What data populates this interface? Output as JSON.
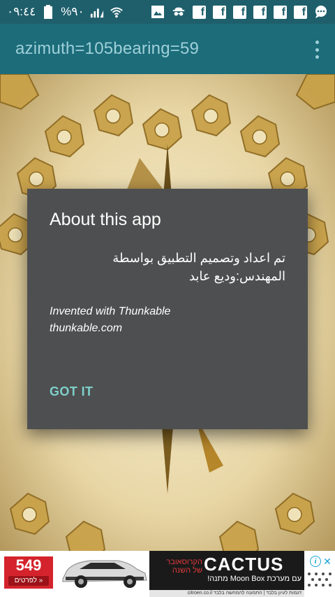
{
  "status_bar": {
    "time": "٠٩:٤٤",
    "battery": "%٩٠",
    "icons": [
      "battery-icon",
      "signal-icon",
      "wifi-icon",
      "gallery-icon",
      "spy-icon",
      "facebook-icon",
      "facebook-icon",
      "facebook-icon",
      "facebook-icon",
      "facebook-icon",
      "facebook-icon",
      "chat-icon"
    ],
    "fb_letter": "f"
  },
  "app_bar": {
    "title": "azimuth=105bearing=59"
  },
  "dialog": {
    "title": "About this app",
    "message": "تم اعداد وتصميم التطبيق بواسطة المهندس:وديع عابد",
    "credit_line1": "Invented with Thunkable",
    "credit_line2": "thunkable.com",
    "button": "GOT IT"
  },
  "ad": {
    "price": "549",
    "price_sub": "לפרטים »",
    "brand": "CACTUS",
    "heb_top": "הקרוסאובר של השנה",
    "heb_bottom": "עם מערכת Moon Box מתנה!",
    "footer": "דגמות לעיון בלבד | התמונה להמחשה בלבד citroen.co.il",
    "info": "i",
    "close": "✕"
  },
  "colors": {
    "status_bar": "#1f5f6c",
    "app_bar": "#1c6c7a",
    "title_text": "#9fd0d8",
    "dialog_bg": "#4e4f50",
    "button_text": "#7ecfcb",
    "ad_red": "#d4232c"
  }
}
